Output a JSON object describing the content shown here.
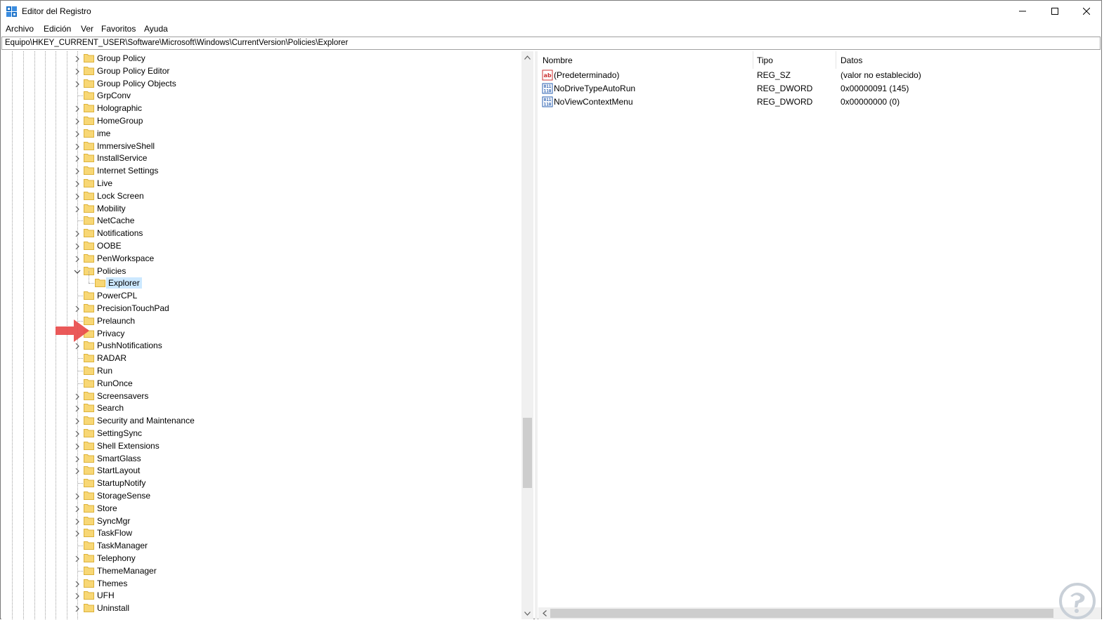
{
  "window": {
    "title": "Editor del Registro",
    "app_icon": "registry-editor-icon",
    "controls": [
      "minimize-icon",
      "maximize-icon",
      "close-icon"
    ]
  },
  "menu": {
    "items": [
      "Archivo",
      "Edición",
      "Ver",
      "Favoritos",
      "Ayuda"
    ]
  },
  "address": {
    "path": "Equipo\\HKEY_CURRENT_USER\\Software\\Microsoft\\Windows\\CurrentVersion\\Policies\\Explorer"
  },
  "tree": {
    "items": [
      {
        "label": "Group Policy",
        "expandable": true
      },
      {
        "label": "Group Policy Editor",
        "expandable": true
      },
      {
        "label": "Group Policy Objects",
        "expandable": true
      },
      {
        "label": "GrpConv",
        "expandable": false
      },
      {
        "label": "Holographic",
        "expandable": true
      },
      {
        "label": "HomeGroup",
        "expandable": true
      },
      {
        "label": "ime",
        "expandable": true
      },
      {
        "label": "ImmersiveShell",
        "expandable": true
      },
      {
        "label": "InstallService",
        "expandable": true
      },
      {
        "label": "Internet Settings",
        "expandable": true
      },
      {
        "label": "Live",
        "expandable": true
      },
      {
        "label": "Lock Screen",
        "expandable": true
      },
      {
        "label": "Mobility",
        "expandable": true
      },
      {
        "label": "NetCache",
        "expandable": false
      },
      {
        "label": "Notifications",
        "expandable": true
      },
      {
        "label": "OOBE",
        "expandable": true
      },
      {
        "label": "PenWorkspace",
        "expandable": true
      },
      {
        "label": "Policies",
        "expandable": true,
        "expanded": true
      },
      {
        "label": "Explorer",
        "expandable": false,
        "child": true,
        "selected": true
      },
      {
        "label": "PowerCPL",
        "expandable": false
      },
      {
        "label": "PrecisionTouchPad",
        "expandable": true
      },
      {
        "label": "Prelaunch",
        "expandable": false
      },
      {
        "label": "Privacy",
        "expandable": false
      },
      {
        "label": "PushNotifications",
        "expandable": true
      },
      {
        "label": "RADAR",
        "expandable": false
      },
      {
        "label": "Run",
        "expandable": false
      },
      {
        "label": "RunOnce",
        "expandable": false
      },
      {
        "label": "Screensavers",
        "expandable": true
      },
      {
        "label": "Search",
        "expandable": true
      },
      {
        "label": "Security and Maintenance",
        "expandable": true
      },
      {
        "label": "SettingSync",
        "expandable": true
      },
      {
        "label": "Shell Extensions",
        "expandable": true
      },
      {
        "label": "SmartGlass",
        "expandable": true
      },
      {
        "label": "StartLayout",
        "expandable": true
      },
      {
        "label": "StartupNotify",
        "expandable": false
      },
      {
        "label": "StorageSense",
        "expandable": true
      },
      {
        "label": "Store",
        "expandable": true
      },
      {
        "label": "SyncMgr",
        "expandable": true
      },
      {
        "label": "TaskFlow",
        "expandable": true
      },
      {
        "label": "TaskManager",
        "expandable": false
      },
      {
        "label": "Telephony",
        "expandable": true
      },
      {
        "label": "ThemeManager",
        "expandable": false
      },
      {
        "label": "Themes",
        "expandable": true
      },
      {
        "label": "UFH",
        "expandable": true
      },
      {
        "label": "Uninstall",
        "expandable": true
      }
    ]
  },
  "list": {
    "columns": [
      "Nombre",
      "Tipo",
      "Datos"
    ],
    "rows": [
      {
        "icon": "string-value-icon",
        "name": "(Predeterminado)",
        "type": "REG_SZ",
        "data": "(valor no establecido)"
      },
      {
        "icon": "binary-value-icon",
        "name": "NoDriveTypeAutoRun",
        "type": "REG_DWORD",
        "data": "0x00000091 (145)"
      },
      {
        "icon": "binary-value-icon",
        "name": "NoViewContextMenu",
        "type": "REG_DWORD",
        "data": "0x00000000 (0)"
      }
    ]
  },
  "annotation": {
    "arrow_icon": "red-pointer-arrow-icon",
    "arrow_color": "#e84b4b"
  },
  "colors": {
    "selection": "#cce8ff",
    "folder": "#f8d775",
    "folder_edge": "#dcb23a"
  }
}
